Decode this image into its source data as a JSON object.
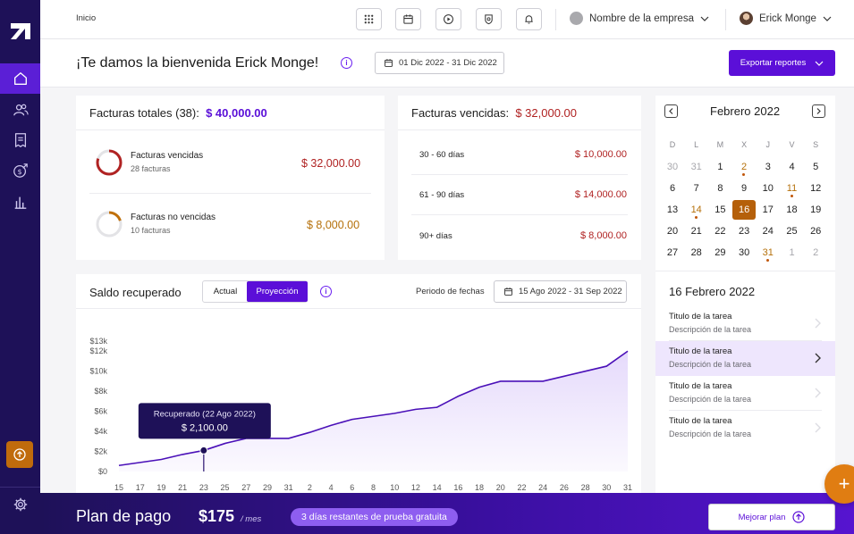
{
  "topbar": {
    "breadcrumb": "Inicio",
    "company": "Nombre de la empresa",
    "user": "Erick Monge"
  },
  "welcome": {
    "title": "¡Te damos la bienvenida Erick Monge!",
    "date_range": "01 Dic 2022 - 31 Dic 2022",
    "export_label": "Exportar reportes"
  },
  "invoices_total": {
    "title_prefix": "Facturas totales",
    "count": "(38):",
    "amount": "$ 40,000.00",
    "items": [
      {
        "title": "Facturas vencidas",
        "sub": "28 facturas",
        "amount": "$ 32,000.00",
        "fraction": 0.8,
        "color": "#b02222"
      },
      {
        "title": "Facturas no vencidas",
        "sub": "10 facturas",
        "amount": "$ 8,000.00",
        "fraction": 0.2,
        "color": "#c0700a"
      }
    ]
  },
  "invoices_overdue": {
    "title": "Facturas vencidas:",
    "amount": "$ 32,000.00",
    "rows": [
      {
        "label": "30 - 60 días",
        "amount": "$ 10,000.00"
      },
      {
        "label": "61 - 90 días",
        "amount": "$ 14,000.00"
      },
      {
        "label": "90+ días",
        "amount": "$ 8,000.00"
      }
    ]
  },
  "calendar": {
    "month": "Febrero 2022",
    "dow": [
      "D",
      "L",
      "M",
      "X",
      "J",
      "V",
      "S"
    ],
    "weeks": [
      [
        {
          "d": "30",
          "s": "muted"
        },
        {
          "d": "31",
          "s": "muted"
        },
        {
          "d": "1"
        },
        {
          "d": "2",
          "s": "orange",
          "mark": true
        },
        {
          "d": "3"
        },
        {
          "d": "4"
        },
        {
          "d": "5"
        }
      ],
      [
        {
          "d": "6"
        },
        {
          "d": "7"
        },
        {
          "d": "8"
        },
        {
          "d": "9"
        },
        {
          "d": "10"
        },
        {
          "d": "11",
          "s": "orange",
          "mark": true
        },
        {
          "d": "12"
        }
      ],
      [
        {
          "d": "13"
        },
        {
          "d": "14",
          "s": "orange",
          "mark": true
        },
        {
          "d": "15"
        },
        {
          "d": "16",
          "s": "selected"
        },
        {
          "d": "17"
        },
        {
          "d": "18"
        },
        {
          "d": "19"
        }
      ],
      [
        {
          "d": "20"
        },
        {
          "d": "21"
        },
        {
          "d": "22"
        },
        {
          "d": "23"
        },
        {
          "d": "24"
        },
        {
          "d": "25"
        },
        {
          "d": "26"
        }
      ],
      [
        {
          "d": "27"
        },
        {
          "d": "28"
        },
        {
          "d": "29"
        },
        {
          "d": "30"
        },
        {
          "d": "31",
          "s": "orange",
          "mark": true
        },
        {
          "d": "1",
          "s": "muted"
        },
        {
          "d": "2",
          "s": "muted"
        }
      ]
    ],
    "selected_title": "16 Febrero 2022",
    "tasks": [
      {
        "title": "Titulo de la tarea",
        "desc": "Descripción de la tarea",
        "active": false
      },
      {
        "title": "Titulo de la tarea",
        "desc": "Descripción de la tarea",
        "active": true
      },
      {
        "title": "Titulo de la tarea",
        "desc": "Descripción de la tarea",
        "active": false
      },
      {
        "title": "Titulo de la tarea",
        "desc": "Descripción de la tarea",
        "active": false
      }
    ]
  },
  "recovered": {
    "title": "Saldo recuperado",
    "toggle_actual": "Actual",
    "toggle_projection": "Proyección",
    "period_label": "Periodo de fechas",
    "period_range": "15 Ago 2022 - 31 Sep 2022",
    "tooltip_title": "Recuperado (22 Ago 2022)",
    "tooltip_value": "$ 2,100.00"
  },
  "chart_data": {
    "type": "area",
    "x": [
      "15",
      "17",
      "19",
      "21",
      "23",
      "25",
      "27",
      "29",
      "31",
      "2",
      "4",
      "6",
      "8",
      "10",
      "12",
      "14",
      "16",
      "18",
      "20",
      "22",
      "24",
      "26",
      "28",
      "30",
      "31"
    ],
    "values": [
      600,
      900,
      1200,
      1700,
      2100,
      2800,
      3300,
      3300,
      3300,
      3900,
      4600,
      5200,
      5500,
      5800,
      6200,
      6400,
      7500,
      8400,
      9000,
      9000,
      9000,
      9500,
      10000,
      10500,
      12000
    ],
    "yticks": [
      "$0",
      "$2k",
      "$4k",
      "$6k",
      "$8k",
      "$10k",
      "$12k",
      "$13k"
    ],
    "ytick_values": [
      0,
      2000,
      4000,
      6000,
      8000,
      10000,
      12000,
      13000
    ],
    "ylim": [
      0,
      13000
    ],
    "highlight_index": 4,
    "line_color": "#4a10b8",
    "fill_color": "#e4d8fb"
  },
  "plan": {
    "title": "Plan de pago",
    "price": "$175",
    "period": "/ mes",
    "trial": "3 días restantes de prueba gratuita",
    "upgrade_label": "Mejorar plan"
  },
  "colors": {
    "sidebar": "#1e1158",
    "accent": "#5b0fd8",
    "orange": "#e07d12"
  }
}
